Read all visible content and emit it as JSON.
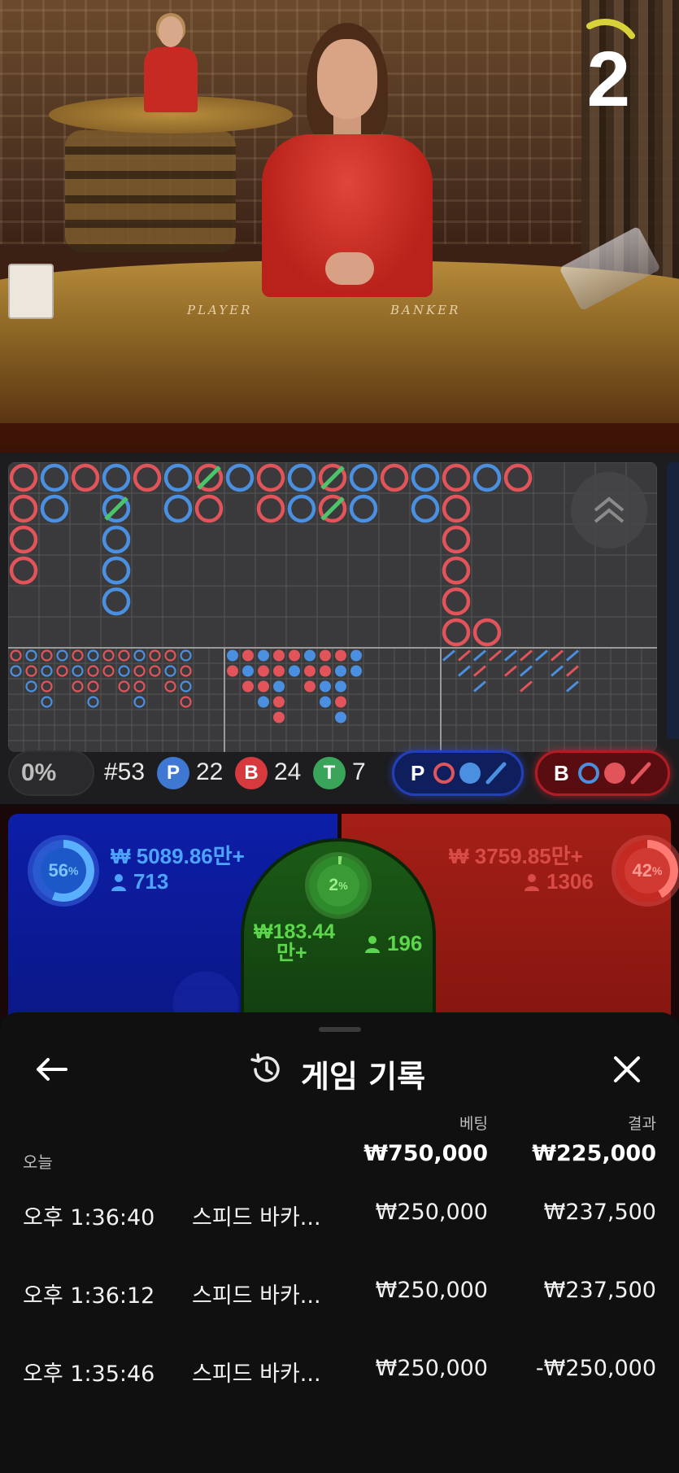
{
  "video": {
    "timer": "2",
    "table_labels": {
      "player": "PLAYER",
      "banker": "BANKER"
    }
  },
  "roadmap": {
    "colors": {
      "player": "#4a8fe0",
      "banker": "#e0545a",
      "tie": "#4cc46a"
    }
  },
  "stats": {
    "percent": "0%",
    "round": "#53",
    "player": {
      "letter": "P",
      "count": "22"
    },
    "banker": {
      "letter": "B",
      "count": "24"
    },
    "tie": {
      "letter": "T",
      "count": "7"
    },
    "ask_player_label": "P",
    "ask_banker_label": "B"
  },
  "betting": {
    "player": {
      "percent": "56",
      "percent_sign": "%",
      "amount": "₩ 5089.86만+",
      "users": "713"
    },
    "tie": {
      "percent": "2",
      "percent_sign": "%",
      "amount_line1": "₩183.44",
      "amount_line2": "만+",
      "users": "196"
    },
    "banker": {
      "percent": "42",
      "percent_sign": "%",
      "amount": "₩ 3759.85만+",
      "users": "1306"
    }
  },
  "history": {
    "title": "게임 기록",
    "col_bet": "베팅",
    "col_result": "결과",
    "today_label": "오늘",
    "total_bet": "₩750,000",
    "total_result": "₩225,000",
    "rows": [
      {
        "time": "오후 1:36:40",
        "game": "스피드 바카...",
        "bet": "₩250,000",
        "result": "₩237,500"
      },
      {
        "time": "오후 1:36:12",
        "game": "스피드 바카...",
        "bet": "₩250,000",
        "result": "₩237,500"
      },
      {
        "time": "오후 1:35:46",
        "game": "스피드 바카...",
        "bet": "₩250,000",
        "result": "-₩250,000"
      }
    ]
  }
}
